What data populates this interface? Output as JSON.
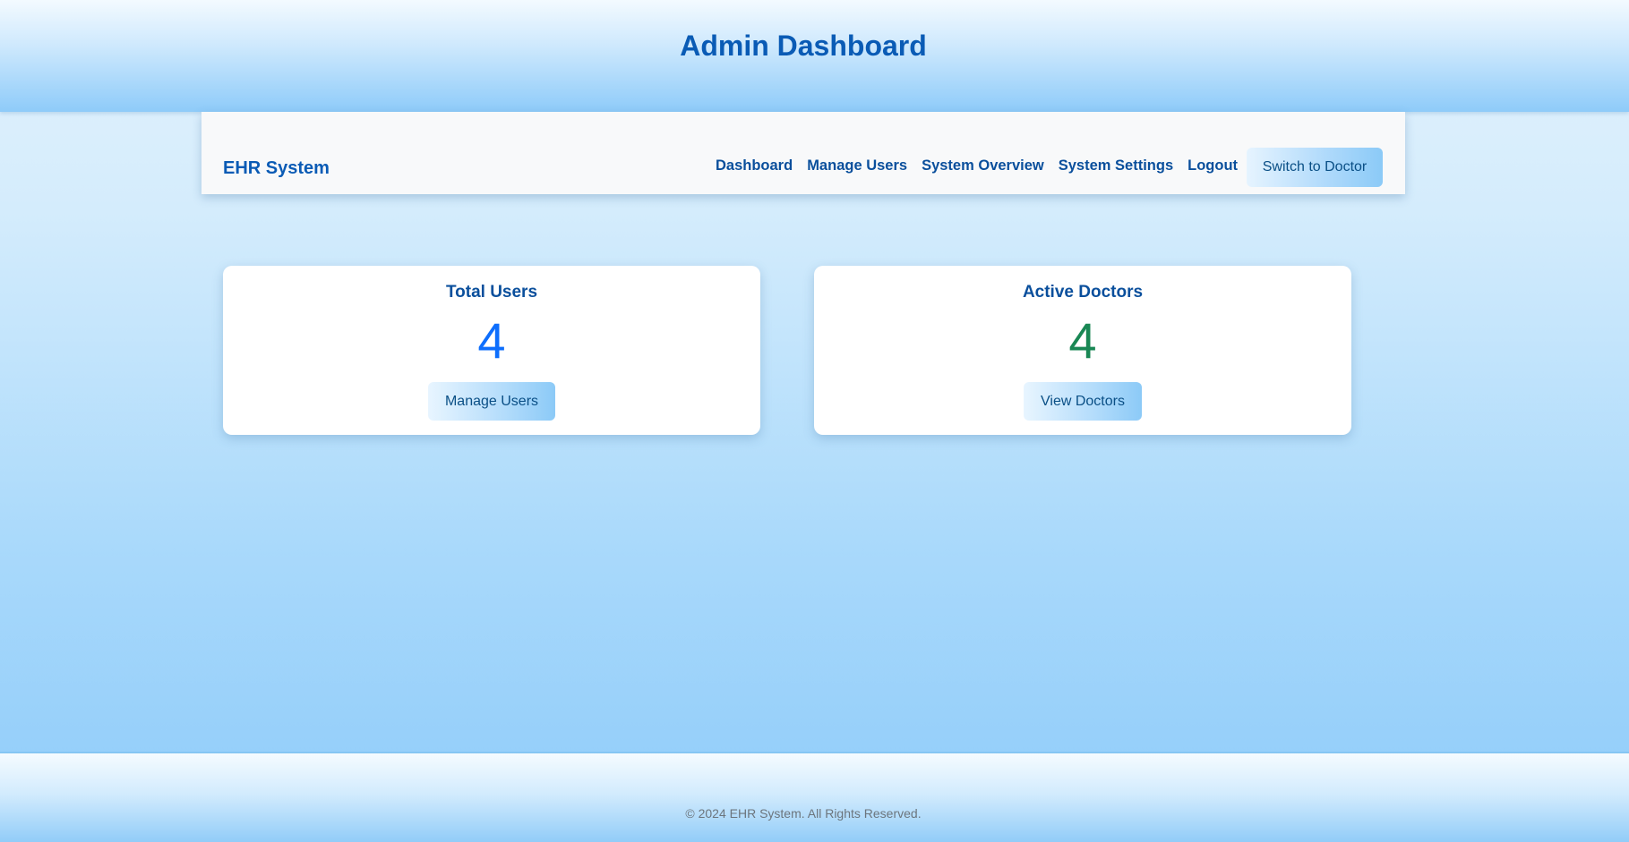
{
  "header": {
    "title": "Admin Dashboard"
  },
  "navbar": {
    "brand": "EHR System",
    "links": [
      {
        "label": "Dashboard"
      },
      {
        "label": "Manage Users"
      },
      {
        "label": "System Overview"
      },
      {
        "label": "System Settings"
      },
      {
        "label": "Logout"
      }
    ],
    "switch_button": "Switch to Doctor"
  },
  "cards": {
    "total_users": {
      "title": "Total Users",
      "value": "4",
      "button": "Manage Users",
      "value_color": "#0d6efd"
    },
    "active_doctors": {
      "title": "Active Doctors",
      "value": "4",
      "button": "View Doctors",
      "value_color": "#198754"
    }
  },
  "footer": {
    "text": "© 2024 EHR System. All Rights Reserved."
  },
  "colors": {
    "primary_text": "#0a5bb5",
    "background_light": "#e3f2fd",
    "background_dark": "#8ecbfa"
  }
}
